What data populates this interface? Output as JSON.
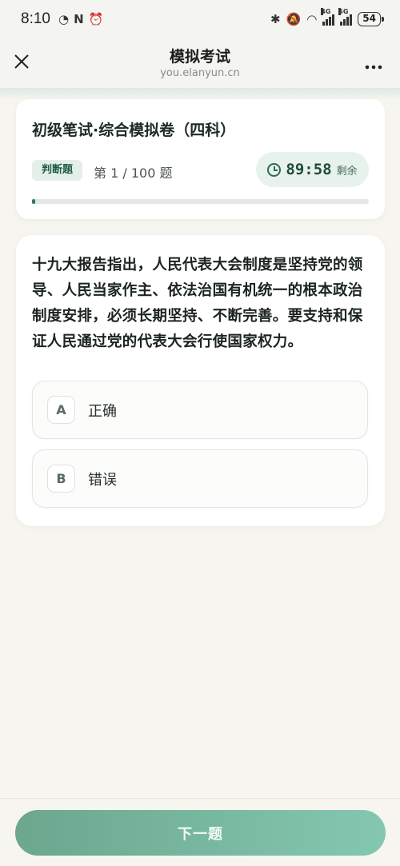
{
  "status_bar": {
    "time": "8:10",
    "icons_left": [
      "gauge-icon",
      "nfc-icon",
      "alarm-icon"
    ],
    "icons_right": [
      "bluetooth-icon",
      "mute-icon",
      "wifi-icon",
      "signal-4g-icon",
      "signal-5g-icon"
    ],
    "signal_4g_label": "4G",
    "signal_5g_label": "5G",
    "battery": "54"
  },
  "header": {
    "title": "模拟考试",
    "url": "you.elanyun.cn",
    "close_icon": "close-icon",
    "more_icon": "more-icon"
  },
  "exam": {
    "paper_title": "初级笔试·综合模拟卷（四科）",
    "question_type": "判断题",
    "progress_text": "第 1 / 100 题",
    "current": 1,
    "total": 100,
    "timer_value": "89:58",
    "timer_label": "剩余",
    "progress_fraction": 0.01
  },
  "question": {
    "text": "十九大报告指出，人民代表大会制度是坚持党的领导、人民当家作主、依法治国有机统一的根本政治制度安排，必须长期坚持、不断完善。要支持和保证人民通过党的代表大会行使国家权力。",
    "options": [
      {
        "letter": "A",
        "text": "正确"
      },
      {
        "letter": "B",
        "text": "错误"
      }
    ]
  },
  "footer": {
    "next_label": "下一题"
  },
  "colors": {
    "accent": "#2f7a55",
    "button_start": "#6ca78e",
    "button_end": "#84c7b0",
    "background": "#f6f5f0"
  }
}
